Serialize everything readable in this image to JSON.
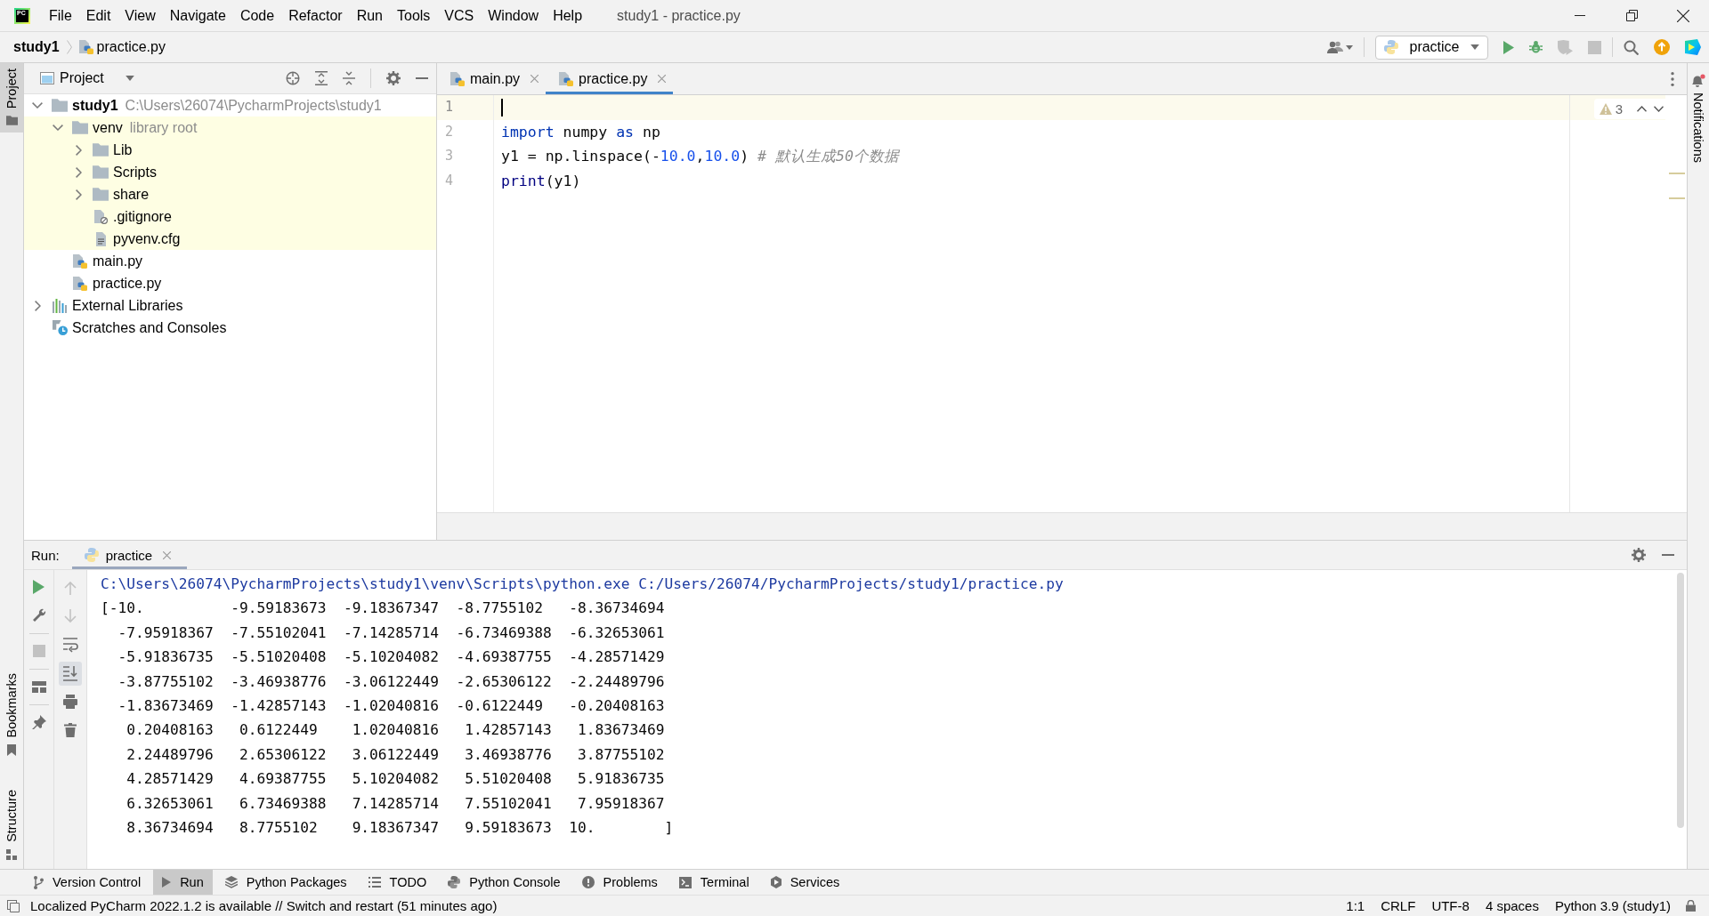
{
  "window": {
    "logo_text": "PC",
    "title": "study1 - practice.py"
  },
  "menu": [
    "File",
    "Edit",
    "View",
    "Navigate",
    "Code",
    "Refactor",
    "Run",
    "Tools",
    "VCS",
    "Window",
    "Help"
  ],
  "breadcrumb": [
    {
      "label": "study1",
      "kind": "project"
    },
    {
      "label": "practice.py",
      "kind": "python_file"
    }
  ],
  "toolbar": {
    "run_config": "practice",
    "buttons": [
      {
        "disabled": false
      },
      {
        "disabled": false
      },
      {
        "disabled": true
      },
      {
        "disabled": true
      }
    ]
  },
  "left_stripe": {
    "top": [
      {
        "label": "Project",
        "selected": true
      }
    ],
    "bottom": [
      {
        "label": "Bookmarks",
        "selected": false
      },
      {
        "label": "Structure",
        "selected": false
      }
    ]
  },
  "project_panel": {
    "title": "Project",
    "tree": [
      {
        "label": "study1",
        "kind": "project",
        "hint": "C:\\Users\\26074\\PycharmProjects\\study1",
        "expanded": true,
        "highlighted": false,
        "children": [
          {
            "label": "venv",
            "kind": "folder",
            "hint": "library root",
            "expanded": true,
            "highlighted": true,
            "children": [
              {
                "label": "Lib",
                "kind": "folder",
                "expanded": false,
                "highlighted": true
              },
              {
                "label": "Scripts",
                "kind": "folder",
                "expanded": false,
                "highlighted": true
              },
              {
                "label": "share",
                "kind": "folder",
                "expanded": false,
                "highlighted": true
              },
              {
                "label": ".gitignore",
                "kind": "ignore_file",
                "highlighted": true
              },
              {
                "label": "pyvenv.cfg",
                "kind": "config_file",
                "highlighted": true
              }
            ]
          },
          {
            "label": "main.py",
            "kind": "python_file",
            "highlighted": false
          },
          {
            "label": "practice.py",
            "kind": "python_file",
            "highlighted": false
          }
        ]
      },
      {
        "label": "External Libraries",
        "kind": "libraries",
        "expanded": false,
        "highlighted": false
      },
      {
        "label": "Scratches and Consoles",
        "kind": "scratches",
        "highlighted": false
      }
    ]
  },
  "editor": {
    "tabs": [
      {
        "label": "main.py",
        "selected": false
      },
      {
        "label": "practice.py",
        "selected": true
      }
    ],
    "warnings": "3",
    "lines": [
      {
        "number": "1",
        "current": true
      },
      {
        "number": "2",
        "current": false,
        "tokens": [
          {
            "text": "import",
            "kind": "keyword"
          },
          {
            "text": " numpy ",
            "kind": "plain"
          },
          {
            "text": "as",
            "kind": "keyword"
          },
          {
            "text": " np",
            "kind": "plain"
          }
        ]
      },
      {
        "number": "3",
        "current": false,
        "tokens": [
          {
            "text": "y1 = np.linspace(-",
            "kind": "plain"
          },
          {
            "text": "10.0",
            "kind": "number"
          },
          {
            "text": ",",
            "kind": "plain"
          },
          {
            "text": "10.0",
            "kind": "number"
          },
          {
            "text": ")",
            "kind": "plain"
          },
          {
            "text": " # 默认生成50个数据",
            "kind": "comment"
          }
        ]
      },
      {
        "number": "4",
        "current": false,
        "tokens": [
          {
            "text": "print",
            "kind": "builtin"
          },
          {
            "text": "(y1)",
            "kind": "plain"
          }
        ]
      }
    ]
  },
  "right_stripe": [
    {
      "label": "Notifications",
      "unread": true
    }
  ],
  "run_panel": {
    "label": "Run:",
    "tabs": [
      {
        "label": "practice",
        "selected": true
      }
    ],
    "run_tools": [
      {
        "disabled": false
      },
      {
        "disabled": false
      },
      {
        "disabled": true
      },
      {
        "disabled": false
      },
      {
        "disabled": false
      }
    ],
    "output_tools": [
      {
        "disabled": true,
        "selected": false
      },
      {
        "disabled": true,
        "selected": false
      },
      {
        "disabled": false,
        "selected": false
      },
      {
        "disabled": false,
        "selected": true
      },
      {
        "disabled": false,
        "selected": false
      },
      {
        "disabled": false,
        "selected": false
      }
    ],
    "output": [
      {
        "kind": "command",
        "text": "C:\\Users\\26074\\PycharmProjects\\study1\\venv\\Scripts\\python.exe C:/Users/26074/PycharmProjects/study1/practice.py"
      },
      {
        "kind": "stdout",
        "text": "[-10.          -9.59183673  -9.18367347  -8.7755102   -8.36734694"
      },
      {
        "kind": "stdout",
        "text": "  -7.95918367  -7.55102041  -7.14285714  -6.73469388  -6.32653061"
      },
      {
        "kind": "stdout",
        "text": "  -5.91836735  -5.51020408  -5.10204082  -4.69387755  -4.28571429"
      },
      {
        "kind": "stdout",
        "text": "  -3.87755102  -3.46938776  -3.06122449  -2.65306122  -2.24489796"
      },
      {
        "kind": "stdout",
        "text": "  -1.83673469  -1.42857143  -1.02040816  -0.6122449   -0.20408163"
      },
      {
        "kind": "stdout",
        "text": "   0.20408163   0.6122449    1.02040816   1.42857143   1.83673469"
      },
      {
        "kind": "stdout",
        "text": "   2.24489796   2.65306122   3.06122449   3.46938776   3.87755102"
      },
      {
        "kind": "stdout",
        "text": "   4.28571429   4.69387755   5.10204082   5.51020408   5.91836735"
      },
      {
        "kind": "stdout",
        "text": "   6.32653061   6.73469388   7.14285714   7.55102041   7.95918367"
      },
      {
        "kind": "stdout",
        "text": "   8.36734694   8.7755102    9.18367347   9.59183673  10.        ]"
      }
    ]
  },
  "tool_window_bar": [
    {
      "label": "Version Control",
      "selected": false
    },
    {
      "label": "Run",
      "selected": true
    },
    {
      "label": "Python Packages",
      "selected": false
    },
    {
      "label": "TODO",
      "selected": false
    },
    {
      "label": "Python Console",
      "selected": false
    },
    {
      "label": "Problems",
      "selected": false
    },
    {
      "label": "Terminal",
      "selected": false
    },
    {
      "label": "Services",
      "selected": false
    }
  ],
  "status_bar": {
    "message": "Localized PyCharm 2022.1.2 is available // Switch and restart (51 minutes ago)",
    "items": [
      "1:1",
      "CRLF",
      "UTF-8",
      "4 spaces",
      "Python 3.9 (study1)"
    ]
  }
}
